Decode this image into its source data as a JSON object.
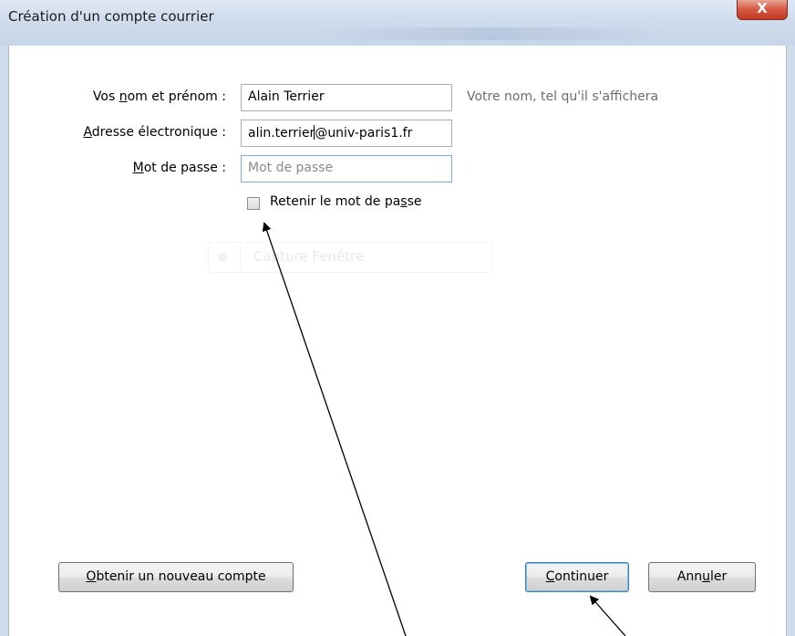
{
  "window": {
    "title": "Création d'un compte courrier",
    "close_symbol": "X"
  },
  "form": {
    "name_label_pre": "Vos ",
    "name_label_u": "n",
    "name_label_post": "om et prénom :",
    "name_value": "Alain Terrier",
    "name_hint": "Votre nom, tel qu'il s'affichera",
    "email_label_u": "A",
    "email_label_post": "dresse électronique :",
    "email_value_before_caret": "alin.terrier",
    "email_value_after_caret": "@univ-paris1.fr",
    "password_label_u": "M",
    "password_label_post": "ot de passe :",
    "password_placeholder": "Mot de passe",
    "remember_pre": "Retenir le mot de pa",
    "remember_u": "s",
    "remember_post": "se",
    "remember_checked": false
  },
  "ghost": {
    "text": "Capture Fenêtre"
  },
  "buttons": {
    "new_account_u": "O",
    "new_account_post": "btenir un nouveau compte",
    "continue_u": "C",
    "continue_post": "ontinuer",
    "cancel_pre": "Ann",
    "cancel_u": "u",
    "cancel_post": "ler"
  },
  "annotations": {
    "arrow_color": "#000000"
  }
}
